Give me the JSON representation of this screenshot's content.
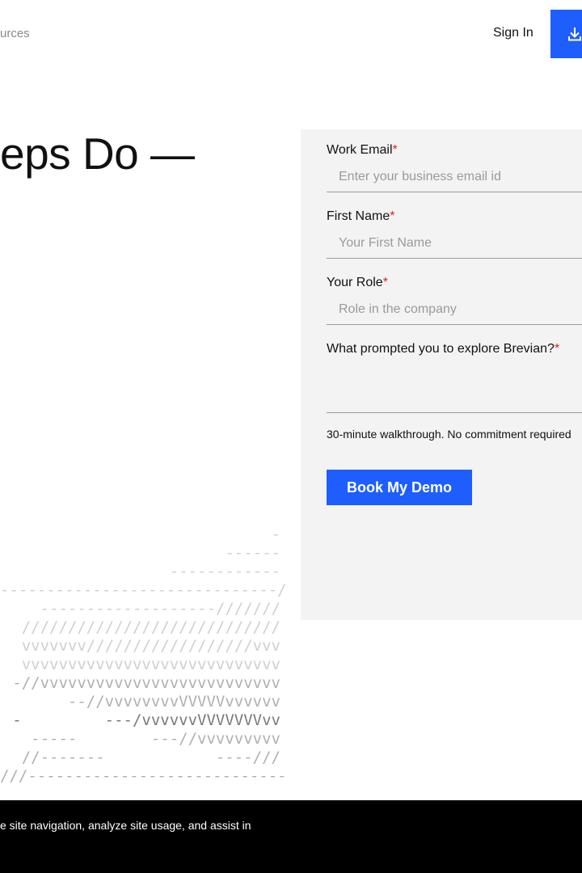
{
  "header": {
    "nav_partial": "urces",
    "signin_label": "Sign In",
    "download_icon": "download-icon",
    "accent": "#1e5eff"
  },
  "hero": {
    "title": "eps Do —"
  },
  "ascii_art": [
    {
      "text": "-",
      "tone": "c1"
    },
    {
      "text": "------",
      "tone": "c1"
    },
    {
      "text": "------------",
      "tone": "c1"
    },
    {
      "text": "------------------------------/",
      "tone": "c1"
    },
    {
      "text": "-------------------///////",
      "tone": "c1"
    },
    {
      "text": "////////////////////////////",
      "tone": "c1"
    },
    {
      "text": "vvvvvvv//////////////////vvv",
      "tone": "c1"
    },
    {
      "text": "vvvvvvvvvvvvvvvvvvvvvvvvvvvv",
      "tone": "c1"
    },
    {
      "text": "-//vvvvvvvvvvvvvvvvvvvvvvvvvv",
      "tone": "c2"
    },
    {
      "text": "--//vvvvvvvvVVVVVvvvvvv",
      "tone": "c2"
    },
    {
      "text": "-         ---/vvvvvvVVVVVVVvv",
      "tone": "c3"
    },
    {
      "text": "-----        ---//vvvvvvvvv",
      "tone": "c2"
    },
    {
      "text": "//-------            ----///",
      "tone": "c2"
    },
    {
      "text": "///----------------------------",
      "tone": "c2"
    }
  ],
  "form": {
    "work_email": {
      "label": "Work Email",
      "required": "*",
      "placeholder": "Enter your business email id"
    },
    "first_name": {
      "label": "First Name",
      "required": "*",
      "placeholder": "Your First Name"
    },
    "role": {
      "label": "Your Role",
      "required": "*",
      "placeholder": "Role in the company"
    },
    "prompt": {
      "label": "What prompted you to explore Brevian?",
      "required": "*"
    },
    "note": "30-minute walkthrough. No commitment required",
    "submit_label": "Book My Demo"
  },
  "cookie": {
    "text": "e site navigation, analyze site usage, and assist in"
  }
}
